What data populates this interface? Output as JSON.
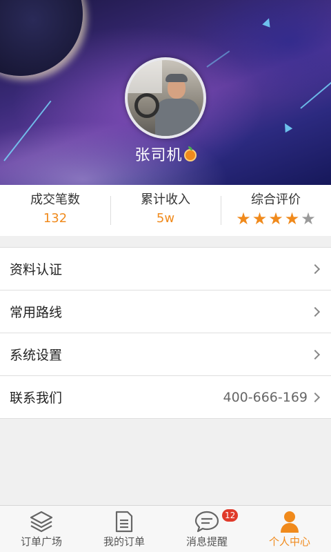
{
  "profile": {
    "name": "张司机"
  },
  "stats": {
    "deals_label": "成交笔数",
    "deals_value": "132",
    "income_label": "累计收入",
    "income_value": "5w",
    "rating_label": "综合评价",
    "rating_value": 4,
    "rating_max": 5
  },
  "menu": {
    "items": [
      {
        "label": "资料认证",
        "value": ""
      },
      {
        "label": "常用路线",
        "value": ""
      },
      {
        "label": "系统设置",
        "value": ""
      },
      {
        "label": "联系我们",
        "value": "400-666-169"
      }
    ]
  },
  "tabs": [
    {
      "label": "订单广场",
      "icon": "layers-icon",
      "active": false
    },
    {
      "label": "我的订单",
      "icon": "document-icon",
      "active": false
    },
    {
      "label": "消息提醒",
      "icon": "chat-bubble-icon",
      "active": false,
      "badge": "12"
    },
    {
      "label": "个人中心",
      "icon": "person-icon",
      "active": true
    }
  ],
  "colors": {
    "accent": "#f08a1c",
    "badge": "#e03a2a"
  }
}
